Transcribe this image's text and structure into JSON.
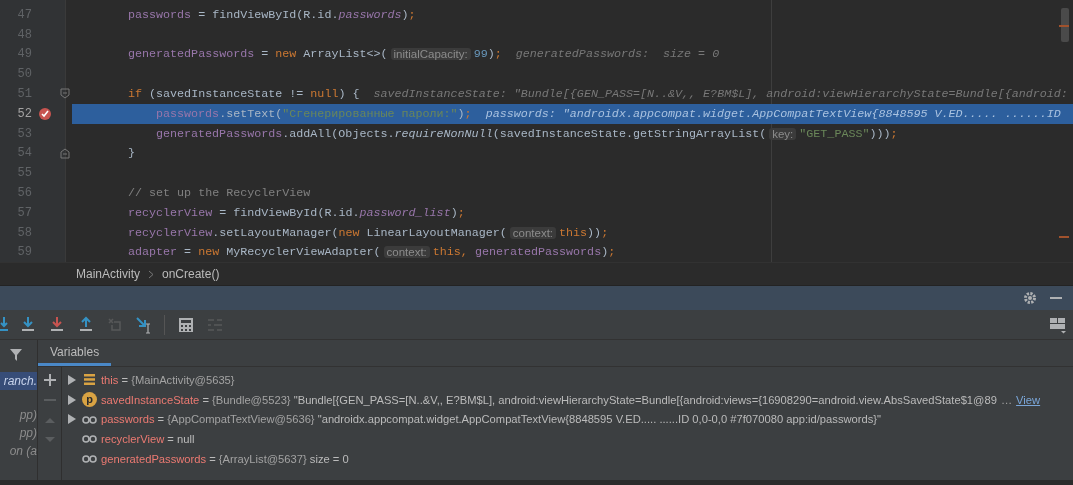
{
  "editor": {
    "lines": [
      {
        "number": "47",
        "breakpoint": false,
        "current": false,
        "parts": [
          {
            "kind": "code",
            "tokens": [
              {
                "kind": "field",
                "text": "passwords"
              },
              {
                "kind": "plain",
                "text": " = findViewById(R.id."
              },
              {
                "kind": "field-italic",
                "text": "passwords"
              },
              {
                "kind": "plain",
                "text": ")"
              },
              {
                "kind": "keyword",
                "text": ";"
              }
            ]
          }
        ]
      },
      {
        "number": "48",
        "breakpoint": false,
        "current": false
      },
      {
        "number": "49",
        "breakpoint": false,
        "current": false,
        "parts": [
          {
            "kind": "code",
            "tokens": [
              {
                "kind": "field",
                "text": "generatedPasswords"
              },
              {
                "kind": "plain",
                "text": " = "
              },
              {
                "kind": "keyword",
                "text": "new"
              },
              {
                "kind": "plain",
                "text": " ArrayList<>("
              }
            ]
          },
          {
            "kind": "hint",
            "text": "initialCapacity:"
          },
          {
            "kind": "code",
            "tokens": [
              {
                "kind": "number",
                "text": "99"
              },
              {
                "kind": "plain",
                "text": ")"
              },
              {
                "kind": "keyword",
                "text": ";"
              }
            ]
          },
          {
            "kind": "debug",
            "text": "generatedPasswords:  size = 0"
          }
        ]
      },
      {
        "number": "50",
        "breakpoint": false,
        "current": false
      },
      {
        "number": "51",
        "breakpoint": false,
        "current": false,
        "fold_open": true,
        "parts": [
          {
            "kind": "code",
            "tokens": [
              {
                "kind": "keyword",
                "text": "if"
              },
              {
                "kind": "plain",
                "text": " (savedInstanceState != "
              },
              {
                "kind": "keyword",
                "text": "null"
              },
              {
                "kind": "plain",
                "text": ") {"
              }
            ]
          },
          {
            "kind": "debug",
            "text": "savedInstanceState: \"Bundle[{GEN_PASS=[N..&V,, E?BM$L], android:viewHierarchyState=Bundle[{android:"
          }
        ],
        "children": [
          {
            "number": "52",
            "breakpoint": true,
            "current": true,
            "parts": [
              {
                "kind": "code",
                "tokens": [
                  {
                    "kind": "field",
                    "text": "passwords"
                  },
                  {
                    "kind": "plain",
                    "text": ".setText("
                  },
                  {
                    "kind": "string",
                    "text": "\"Сгенерированные пароли:\""
                  },
                  {
                    "kind": "plain",
                    "text": ")"
                  },
                  {
                    "kind": "keyword",
                    "text": ";"
                  }
                ]
              },
              {
                "kind": "debug",
                "text": "passwords: \"androidx.appcompat.widget.AppCompatTextView{8848595 V.ED..... ......ID"
              }
            ]
          },
          {
            "number": "53",
            "breakpoint": false,
            "current": false,
            "parts": [
              {
                "kind": "code",
                "tokens": [
                  {
                    "kind": "field",
                    "text": "generatedPasswords"
                  },
                  {
                    "kind": "plain",
                    "text": ".addAll(Objects."
                  },
                  {
                    "kind": "method-italic",
                    "text": "requireNonNull"
                  },
                  {
                    "kind": "plain",
                    "text": "(savedInstanceState.getStringArrayList("
                  }
                ]
              },
              {
                "kind": "hint",
                "text": "key:"
              },
              {
                "kind": "code",
                "tokens": [
                  {
                    "kind": "string",
                    "text": "\"GET_PASS\""
                  },
                  {
                    "kind": "plain",
                    "text": ")))"
                  },
                  {
                    "kind": "keyword",
                    "text": ";"
                  }
                ]
              }
            ]
          }
        ]
      },
      {
        "number": "54",
        "breakpoint": false,
        "current": false,
        "fold_close": true,
        "parts": [
          {
            "kind": "code",
            "tokens": [
              {
                "kind": "plain",
                "text": "}"
              }
            ]
          }
        ]
      },
      {
        "number": "55",
        "breakpoint": false,
        "current": false
      },
      {
        "number": "56",
        "breakpoint": false,
        "current": false,
        "parts": [
          {
            "kind": "code",
            "tokens": [
              {
                "kind": "comment",
                "text": "// set up the RecyclerView"
              }
            ]
          }
        ]
      },
      {
        "number": "57",
        "breakpoint": false,
        "current": false,
        "parts": [
          {
            "kind": "code",
            "tokens": [
              {
                "kind": "field",
                "text": "recyclerView"
              },
              {
                "kind": "plain",
                "text": " = findViewById(R.id."
              },
              {
                "kind": "field-italic",
                "text": "password_list"
              },
              {
                "kind": "plain",
                "text": ")"
              },
              {
                "kind": "keyword",
                "text": ";"
              }
            ]
          }
        ]
      },
      {
        "number": "58",
        "breakpoint": false,
        "current": false,
        "parts": [
          {
            "kind": "code",
            "tokens": [
              {
                "kind": "field",
                "text": "recyclerView"
              },
              {
                "kind": "plain",
                "text": ".setLayoutManager("
              },
              {
                "kind": "keyword",
                "text": "new"
              },
              {
                "kind": "plain",
                "text": " LinearLayoutManager("
              }
            ]
          },
          {
            "kind": "hint",
            "text": "context:"
          },
          {
            "kind": "code",
            "tokens": [
              {
                "kind": "keyword",
                "text": "this"
              },
              {
                "kind": "plain",
                "text": "))"
              },
              {
                "kind": "keyword",
                "text": ";"
              }
            ]
          }
        ]
      },
      {
        "number": "59",
        "breakpoint": false,
        "current": false,
        "parts": [
          {
            "kind": "code",
            "tokens": [
              {
                "kind": "field",
                "text": "adapter"
              },
              {
                "kind": "plain",
                "text": " = "
              },
              {
                "kind": "keyword",
                "text": "new"
              },
              {
                "kind": "plain",
                "text": " MyRecyclerViewAdapter("
              }
            ]
          },
          {
            "kind": "hint",
            "text": "context:"
          },
          {
            "kind": "code",
            "tokens": [
              {
                "kind": "keyword",
                "text": "this, "
              },
              {
                "kind": "field",
                "text": "generatedPasswords"
              },
              {
                "kind": "plain",
                "text": ")"
              },
              {
                "kind": "keyword",
                "text": ";"
              }
            ]
          }
        ]
      }
    ]
  },
  "breadcrumbs": [
    "MainActivity",
    "onCreate()"
  ],
  "debugger": {
    "toolbar": [
      {
        "kind": "step-over",
        "disabled": false
      },
      {
        "kind": "step-into",
        "disabled": false
      },
      {
        "kind": "force-step-into",
        "disabled": false
      },
      {
        "kind": "step-out",
        "disabled": false
      },
      {
        "kind": "drop-frame",
        "disabled": true
      },
      {
        "kind": "run-to-cursor",
        "disabled": false
      },
      {
        "kind": "separator"
      },
      {
        "kind": "evaluate",
        "disabled": false
      },
      {
        "kind": "trace",
        "disabled": true
      }
    ],
    "frames": [
      {
        "text": "ranch.",
        "selected": true
      },
      {
        "text": "pp)",
        "selected": false
      },
      {
        "text": "pp)",
        "selected": false
      },
      {
        "text": "on (a",
        "selected": false
      }
    ],
    "tabs": [
      {
        "label": "Variables",
        "selected": true
      }
    ],
    "variables": [
      {
        "kind": "object",
        "expandable": true,
        "name": "this",
        "operator": "=",
        "type": "{MainActivity@5635}"
      },
      {
        "kind": "parameter",
        "icon_letter": "p",
        "expandable": true,
        "name": "savedInstanceState",
        "operator": "=",
        "type": "{Bundle@5523}",
        "value": "\"Bundle[{GEN_PASS=[N..&V,, E?BM$L], android:viewHierarchyState=Bundle[{android:views={16908290=android.view.AbsSavedState$1@89",
        "more": "…",
        "link": "View"
      },
      {
        "kind": "local",
        "expandable": true,
        "name": "passwords",
        "operator": "=",
        "type": "{AppCompatTextView@5636}",
        "value": "\"androidx.appcompat.widget.AppCompatTextView{8848595 V.ED..... ......ID 0,0-0,0 #7f070080 app:id/passwords}\""
      },
      {
        "kind": "local",
        "expandable": false,
        "name": "recyclerView",
        "operator": "=",
        "value": "null"
      },
      {
        "kind": "local",
        "expandable": false,
        "name": "generatedPasswords",
        "operator": "=",
        "type": "{ArrayList@5637}",
        "value": "size = 0"
      }
    ]
  }
}
